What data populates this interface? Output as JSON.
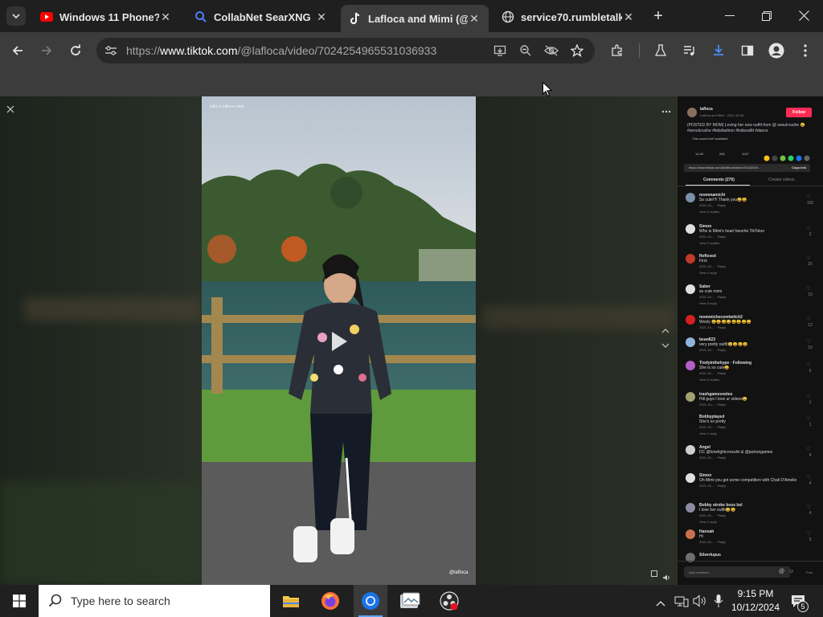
{
  "browser": {
    "tabs": [
      {
        "title": "Windows 11 Phone? | Y",
        "icon": "youtube-icon",
        "color": "#ff0000"
      },
      {
        "title": "CollabNet SearXNG",
        "icon": "search-icon",
        "color": "#3b6cf6"
      },
      {
        "title": "Lafloca and Mimi (@la",
        "icon": "tiktok-icon",
        "color": "#ffffff"
      },
      {
        "title": "service70.rumbletalk.c",
        "icon": "globe-icon",
        "color": "#cfcfcf"
      }
    ],
    "new_tab": "+",
    "url_prefix": "https://",
    "url_host": "www.tiktok.com",
    "url_path": "/@lafloca/video/7024254965531036933"
  },
  "video": {
    "watermark": "@lafloca",
    "top_caption": "lafloca lafloca mimi"
  },
  "panel": {
    "author": "lafloca",
    "author_sub": "Lafloca and Mimi · 2021-10-28",
    "follow": "Follow",
    "caption": "(POSTED BY MOM) Loving her new outfit from @ seoulcrushe 😀 #seoulcrushe #kidsfashion #kidsoutfit #dance",
    "sound": "This sound isn't available.",
    "stats": [
      "14.9K",
      "265",
      "1027"
    ],
    "link": "https://www.tiktok.com/@lafloca/video/70242549...",
    "copy_link": "Copy link",
    "tabs": [
      "Comments (276)",
      "Creator videos"
    ],
    "comments": [
      {
        "user": "mommamichi",
        "text": "So cute!!!! Thank you😀😀",
        "meta": "2021-10-... · Reply",
        "more": "View 3 replies",
        "likes": "102",
        "color": "#7a8fa8"
      },
      {
        "user": "Simon",
        "text": "Who is Mimi's heart favorite TikToker",
        "meta": "2021-10-... · Reply",
        "more": "View 2 replies",
        "likes": "2",
        "color": "#e0e0e0"
      },
      {
        "user": "Reflexed",
        "text": "First",
        "meta": "2021-10-... · Reply",
        "more": "View 1 reply",
        "likes": "15",
        "color": "#c0392b"
      },
      {
        "user": "Saber",
        "text": "so cute mimi",
        "meta": "2021-10-... · Reply",
        "more": "View 3 reply",
        "likes": "10",
        "color": "#e0e0e0"
      },
      {
        "user": "mommichecomtwitch2",
        "text": "Wooly 😀😀😀😀😀😀😀😀",
        "meta": "2021-10-... · Reply",
        "more": "",
        "likes": "12",
        "color": "#d62020"
      },
      {
        "user": "bean823",
        "text": "very pretty outfit😀😀😀😀",
        "meta": "2021-10-... · Reply",
        "more": "",
        "likes": "10",
        "color": "#8fb3d9"
      },
      {
        "user": "Ttodyinthehype · Following",
        "text": "She is so cute😀",
        "meta": "2021-10-... · Reply",
        "more": "View 3 replies",
        "likes": "5",
        "color": "#b45fc7"
      },
      {
        "user": "trashgamesnotes",
        "text": "Hill guys I love ur videos😀",
        "meta": "2021-10-... · Reply",
        "more": "",
        "likes": "1",
        "color": "#a0a070"
      },
      {
        "user": "Bobbyplayed",
        "text": "She's so pretty",
        "meta": "2021-10-... · Reply",
        "more": "View 1 reply",
        "likes": "1",
        "color": "#111111"
      },
      {
        "user": "Angel",
        "text": "DC @lonelightconsulin & @jackongames",
        "meta": "2021-10-... · Reply",
        "more": "",
        "likes": "4",
        "color": "#d0d0d0"
      },
      {
        "user": "Simon",
        "text": "Oh Mimi you got some competition with Chali D'Amelio",
        "meta": "2021-10-... · Reply",
        "more": "",
        "likes": "4",
        "color": "#e0e0e0"
      },
      {
        "user": "Bobby stroke boss bel",
        "text": "I love her outfit😀😀",
        "meta": "2021-10-... · Reply",
        "more": "View 1 reply",
        "likes": "4",
        "color": "#8a8aa0"
      },
      {
        "user": "Hannah",
        "text": "Hi",
        "meta": "2021-10-... · Reply",
        "more": "",
        "likes": "3",
        "color": "#c87050"
      },
      {
        "user": "Silverlupus",
        "text": "",
        "meta": "",
        "more": "",
        "likes": "",
        "color": "#6e6e6e"
      }
    ],
    "add_comment": "Add comment...",
    "post": "Post"
  },
  "taskbar": {
    "search_placeholder": "Type here to search",
    "time": "9:15 PM",
    "date": "10/12/2024",
    "notif_count": "5"
  }
}
